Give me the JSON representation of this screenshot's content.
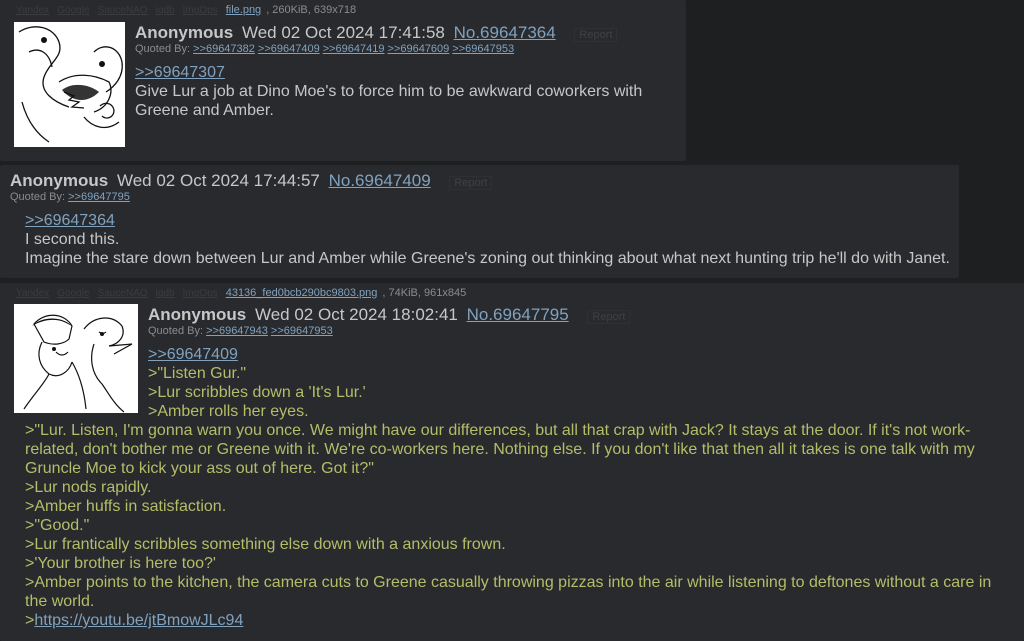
{
  "posts": [
    {
      "file": {
        "search_links": [
          "Yandex",
          "Google",
          "SauceNAO",
          "iqdb",
          "ImgOps"
        ],
        "name": "file.png",
        "meta": ", 260KiB, 639x718"
      },
      "name": "Anonymous",
      "date": "Wed 02 Oct 2024 17:41:58",
      "no": "No.69647364",
      "report": "Report",
      "quoted_by_label": "Quoted By:",
      "quoted_by": [
        ">>69647382",
        ">>69647409",
        ">>69647419",
        ">>69647609",
        ">>69647953"
      ],
      "reply_to": ">>69647307",
      "lines": [
        "Give Lur a job at Dino Moe's to force him to be awkward coworkers with",
        "Greene and Amber."
      ]
    },
    {
      "name": "Anonymous",
      "date": "Wed 02 Oct 2024 17:44:57",
      "no": "No.69647409",
      "report": "Report",
      "quoted_by_label": "Quoted By:",
      "quoted_by": [
        ">>69647795"
      ],
      "reply_to": ">>69647364",
      "lines": [
        "I second this.",
        "Imagine the stare down between Lur and Amber while Greene's zoning out thinking about what next hunting trip he'll do with Janet."
      ]
    },
    {
      "file": {
        "search_links": [
          "Yandex",
          "Google",
          "SauceNAO",
          "iqdb",
          "ImgOps"
        ],
        "name": "43136_fed0bcb290bc9803.png",
        "meta": ", 74KiB, 961x845"
      },
      "name": "Anonymous",
      "date": "Wed 02 Oct 2024 18:02:41",
      "no": "No.69647795",
      "report": "Report",
      "quoted_by_label": "Quoted By:",
      "quoted_by": [
        ">>69647943",
        ">>69647953"
      ],
      "reply_to": ">>69647409",
      "green_short": [
        ">\"Listen Gur.\"",
        ">Lur scribbles down a 'It's Lur.'",
        ">Amber rolls her eyes."
      ],
      "green_long": [
        ">\"Lur. Listen, I'm gonna warn you once. We might have our differences, but all that crap with Jack? It stays at the door. If it's not work-",
        "related, don't bother me or Greene with it. We're co-workers here. Nothing else. If you don't like that then all it takes is one talk with my",
        "Gruncle Moe to kick your ass out of here. Got it?\"",
        ">Lur nods rapidly.",
        ">Amber huffs in satisfaction.",
        ">\"Good.\"",
        ">Lur frantically scribbles something else down with a anxious frown.",
        ">'Your brother is here too?'",
        ">Amber points to the kitchen, the camera cuts to Greene casually throwing pizzas into the air while listening to deftones without a care in",
        "the world."
      ],
      "link_prefix": ">",
      "link": "https://youtu.be/jtBmowJLc94"
    }
  ],
  "colors": {
    "bg": "#1d1f21",
    "post_bg": "#282a2e",
    "link": "#81a2be",
    "greentext": "#b5bd68",
    "text": "#c5c8c6"
  }
}
